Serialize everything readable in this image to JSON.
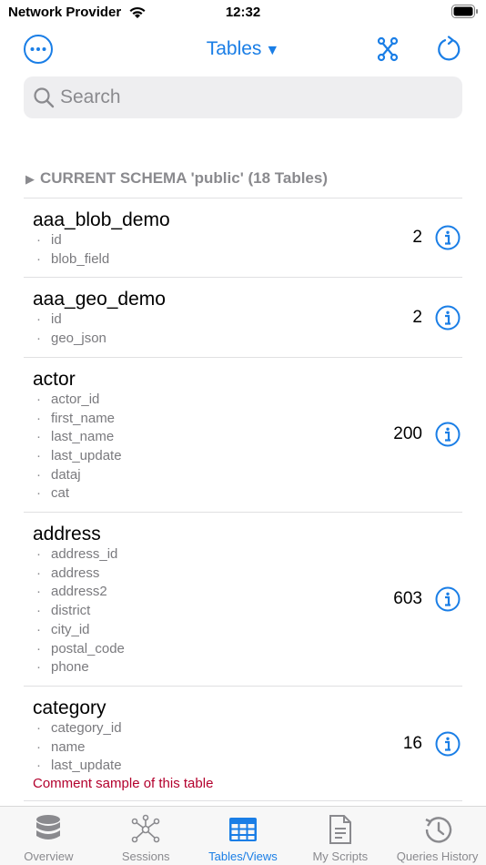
{
  "status_bar": {
    "carrier": "Network Provider",
    "time": "12:32"
  },
  "nav": {
    "title": "Tables",
    "caret": "▼"
  },
  "search": {
    "placeholder": "Search",
    "value": ""
  },
  "section": {
    "title": "CURRENT SCHEMA 'public' (18 Tables)"
  },
  "tables": [
    {
      "name": "aaa_blob_demo",
      "columns": [
        "id",
        "blob_field"
      ],
      "count": "2"
    },
    {
      "name": "aaa_geo_demo",
      "columns": [
        "id",
        "geo_json"
      ],
      "count": "2"
    },
    {
      "name": "actor",
      "columns": [
        "actor_id",
        "first_name",
        "last_name",
        "last_update",
        "dataj",
        "cat"
      ],
      "count": "200"
    },
    {
      "name": "address",
      "columns": [
        "address_id",
        "address",
        "address2",
        "district",
        "city_id",
        "postal_code",
        "phone"
      ],
      "count": "603"
    },
    {
      "name": "category",
      "columns": [
        "category_id",
        "name",
        "last_update"
      ],
      "count": "16",
      "comment": "Comment sample of this table"
    }
  ],
  "tabbar": {
    "tabs": [
      {
        "label": "Overview",
        "icon": "database-icon"
      },
      {
        "label": "Sessions",
        "icon": "network-icon"
      },
      {
        "label": "Tables/Views",
        "icon": "table-icon"
      },
      {
        "label": "My Scripts",
        "icon": "document-icon"
      },
      {
        "label": "Queries History",
        "icon": "history-icon"
      }
    ],
    "active": "Tables/Views"
  },
  "colors": {
    "accent": "#1a7ee6",
    "secondary_text": "#8a8a8e",
    "comment": "#b3002d"
  }
}
